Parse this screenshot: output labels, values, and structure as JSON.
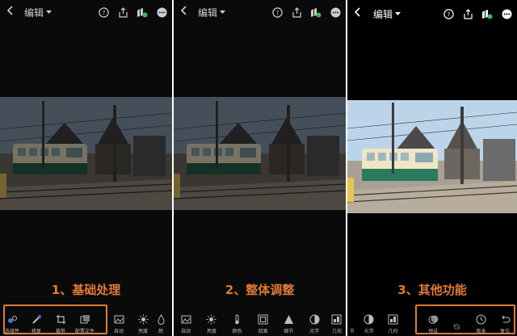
{
  "panels": [
    {
      "header": {
        "title": "编辑"
      },
      "caption": "1、基础处理",
      "tools": [
        "选择性",
        "修复",
        "裁剪",
        "配置文件",
        "自动",
        "亮度",
        "颜"
      ]
    },
    {
      "header": {
        "title": "编辑"
      },
      "caption": "2、整体调整",
      "tools": [
        "自动",
        "亮度",
        "颜色",
        "效果",
        "细节",
        "光学",
        "几何"
      ]
    },
    {
      "header": {
        "title": "编辑"
      },
      "caption": "3、其他功能",
      "tools": [
        "节",
        "光学",
        "几何",
        "预设",
        "",
        "版本",
        "复位"
      ]
    }
  ],
  "icons": {
    "back": "chevron-left-icon",
    "dropdown": "caret-down-icon",
    "help": "help-icon",
    "share": "share-icon",
    "cloud": "cloud-sync-icon",
    "more": "more-icon"
  },
  "colors": {
    "accent": "#e07a36",
    "panel_bg": "#0a0a0a"
  }
}
